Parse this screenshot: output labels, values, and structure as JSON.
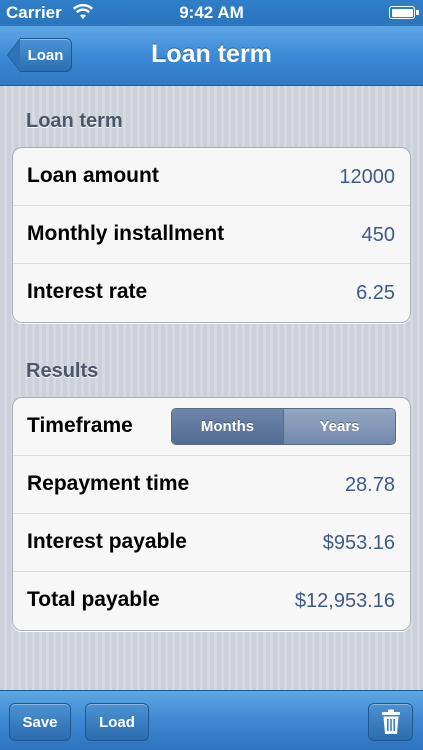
{
  "status_bar": {
    "carrier": "Carrier",
    "time": "9:42 AM",
    "wifi_icon": "wifi-icon",
    "battery_icon": "battery-icon"
  },
  "nav_bar": {
    "back_label": "Loan",
    "title": "Loan term"
  },
  "loan_term_section": {
    "header": "Loan term",
    "rows": [
      {
        "label": "Loan amount",
        "value": "12000"
      },
      {
        "label": "Monthly installment",
        "value": "450"
      },
      {
        "label": "Interest rate",
        "value": "6.25"
      }
    ]
  },
  "results_section": {
    "header": "Results",
    "timeframe": {
      "label": "Timeframe",
      "options": [
        "Months",
        "Years"
      ],
      "selected": "Months"
    },
    "rows": [
      {
        "label": "Repayment time",
        "value": "28.78"
      },
      {
        "label": "Interest payable",
        "value": "$953.16"
      },
      {
        "label": "Total payable",
        "value": "$12,953.16"
      }
    ]
  },
  "toolbar": {
    "save_label": "Save",
    "load_label": "Load",
    "trash_icon": "trash-icon"
  },
  "colors": {
    "accent": "#3d88d2",
    "value_text": "#3f5a8a",
    "section_header": "#4c566a"
  }
}
